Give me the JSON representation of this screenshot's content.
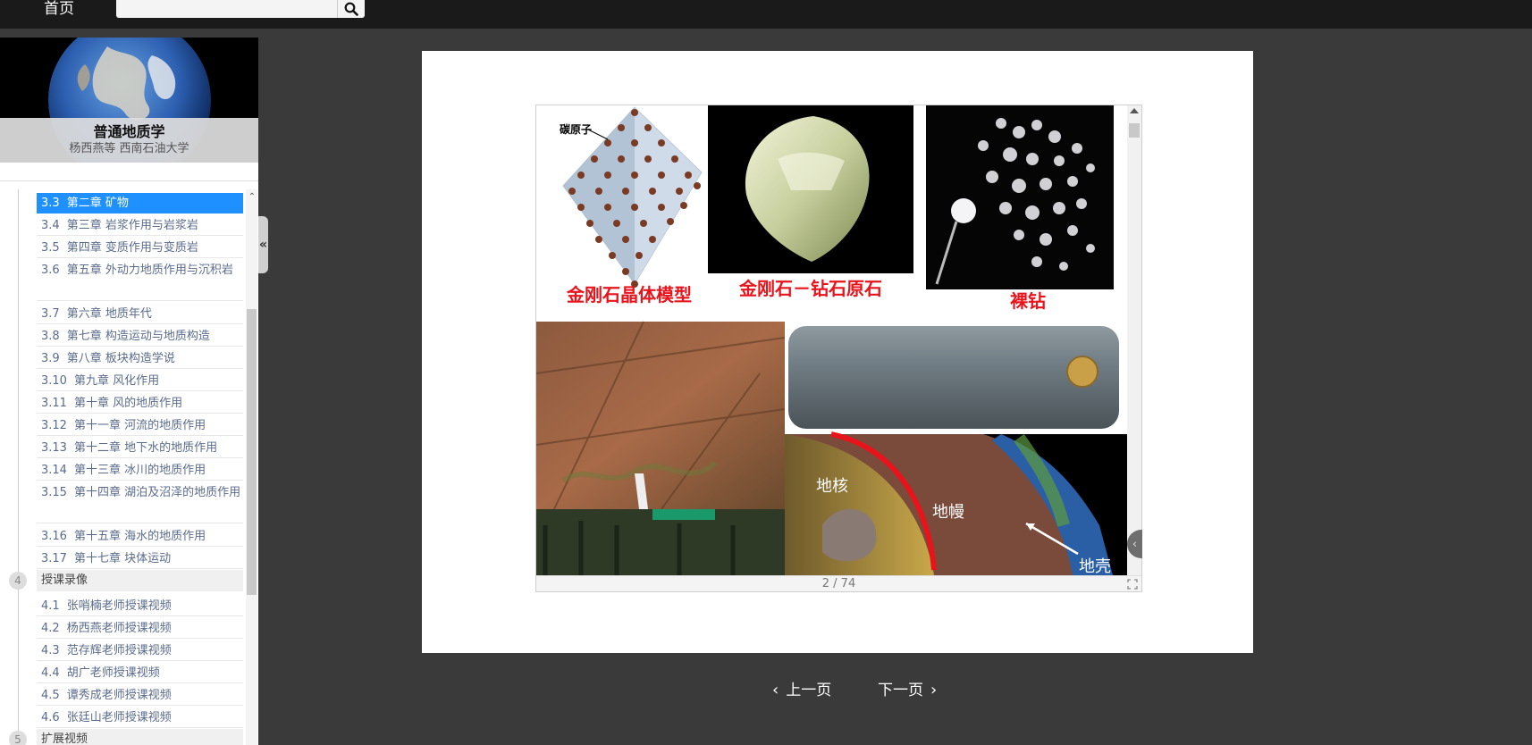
{
  "topbar": {
    "home_label": "首页",
    "search_placeholder": "",
    "search_icon": "search-icon"
  },
  "sidebar": {
    "course_title": "普通地质学",
    "course_author": "杨西燕等 西南石油大学",
    "collapse_label": "«",
    "toc": [
      {
        "num": "3.3",
        "label": "第二章  矿物",
        "active": true
      },
      {
        "num": "3.4",
        "label": "第三章 岩浆作用与岩浆岩"
      },
      {
        "num": "3.5",
        "label": "第四章 变质作用与变质岩"
      },
      {
        "num": "3.6",
        "label": "第五章 外动力地质作用与沉积岩"
      },
      {
        "num": "3.7",
        "label": "第六章  地质年代"
      },
      {
        "num": "3.8",
        "label": "第七章  构造运动与地质构造"
      },
      {
        "num": "3.9",
        "label": "第八章  板块构造学说"
      },
      {
        "num": "3.10",
        "label": "第九章  风化作用"
      },
      {
        "num": "3.11",
        "label": "第十章  风的地质作用"
      },
      {
        "num": "3.12",
        "label": "第十一章  河流的地质作用"
      },
      {
        "num": "3.13",
        "label": "第十二章  地下水的地质作用"
      },
      {
        "num": "3.14",
        "label": "第十三章 冰川的地质作用"
      },
      {
        "num": "3.15",
        "label": "第十四章  湖泊及沼泽的地质作用"
      },
      {
        "num": "3.16",
        "label": "第十五章  海水的地质作用"
      },
      {
        "num": "3.17",
        "label": "第十七章  块体运动"
      }
    ],
    "section4": {
      "num": "4",
      "label": "授课录像"
    },
    "videos": [
      {
        "num": "4.1",
        "label": "张哨楠老师授课视频"
      },
      {
        "num": "4.2",
        "label": "杨西燕老师授课视频"
      },
      {
        "num": "4.3",
        "label": "范存辉老师授课视频"
      },
      {
        "num": "4.4",
        "label": "胡广老师授课视频"
      },
      {
        "num": "4.5",
        "label": "谭秀成老师授课视频"
      },
      {
        "num": "4.6",
        "label": "张廷山老师授课视频"
      }
    ],
    "section5": {
      "num": "5",
      "label": "扩展视频"
    }
  },
  "slide": {
    "carbon_label": "碳原子",
    "caption_crystal": "金刚石晶体模型",
    "caption_rough": "金刚石－钻石原石",
    "caption_bare": "裸钻",
    "label_core": "地核",
    "label_mantle": "地幔",
    "label_crust": "地壳",
    "colors": {
      "caption_red": "#e8141c"
    }
  },
  "viewer": {
    "page_indicator": "2 / 74",
    "side_handle": "‹",
    "fullscreen_icon": "fullscreen-icon"
  },
  "nav": {
    "prev_label": "上一页",
    "next_label": "下一页"
  }
}
